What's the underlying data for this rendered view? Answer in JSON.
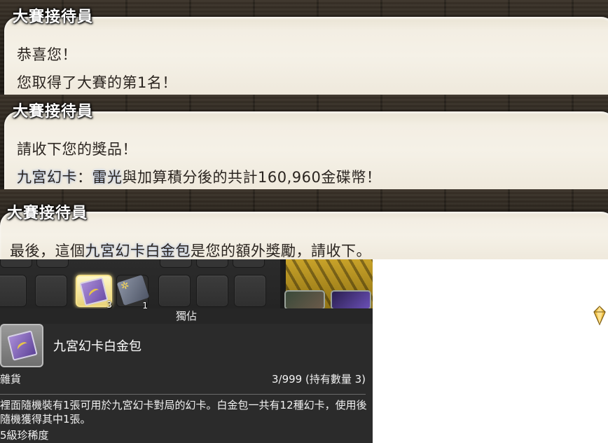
{
  "dialogues": [
    {
      "speaker": "大賽接待員",
      "lines": [
        {
          "text": "恭喜您！"
        },
        {
          "text": "您取得了大賽的第1名！"
        }
      ]
    },
    {
      "speaker": "大賽接待員",
      "lines": [
        {
          "text": "請收下您的獎品！"
        },
        {
          "highlight_1": "九宮幻卡",
          "sep": "：",
          "highlight_2": "雷光",
          "rest": "與加算積分後的共計160,960金碟幣！"
        }
      ]
    },
    {
      "speaker": "大賽接待員",
      "lines": [
        {
          "prefix": "最後，這個",
          "highlight": "九宮幻卡白金包",
          "rest": "是您的額外獎勵，請收下。"
        }
      ]
    }
  ],
  "inventory": {
    "slots": [
      {
        "item": "triple-triad-card-icon",
        "quantity": "3"
      },
      {
        "item": "card-pack-icon",
        "quantity": "1"
      }
    ]
  },
  "tooltip": {
    "tag": "獨佔",
    "item_name": "九宮幻卡白金包",
    "category": "雜貨",
    "count": "3/999 (持有數量 3)",
    "description": "裡面隨機裝有1張可用於九宮幻卡對局的幻卡。白金包一共有12種幻卡，使用後隨機獲得其中1張。",
    "rarity": "5級珍稀度"
  },
  "colors": {
    "bubble": "#f5f1e7",
    "speaker_text": "#ffffff",
    "dialogue_text": "#2b2520",
    "highlight_glow": "#a9bde0",
    "tooltip_bg": "#2b2b2b",
    "selected_slot": "#f6e28a"
  }
}
